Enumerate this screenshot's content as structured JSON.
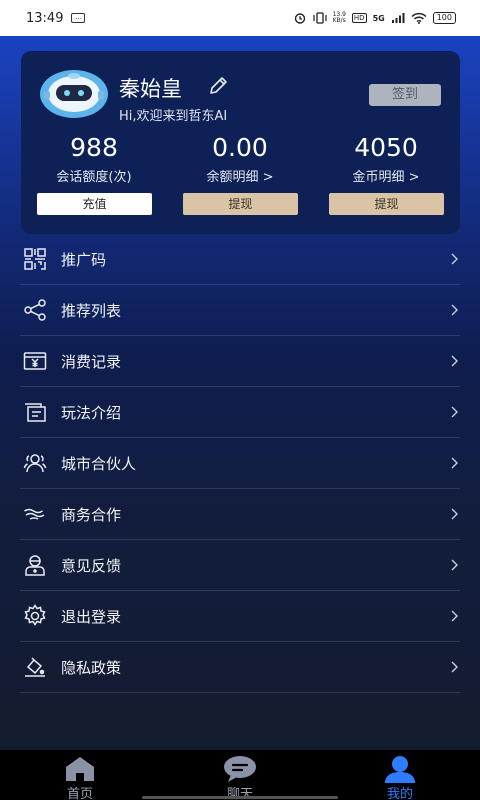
{
  "status": {
    "time": "13:49",
    "net_speed": "13.9\nKB/s",
    "hd": "HD",
    "signal": "5G",
    "battery": "100"
  },
  "profile": {
    "name": "秦始皇",
    "welcome": "Hi,欢迎来到哲东AI",
    "signin_label": "签到"
  },
  "stats": [
    {
      "value": "988",
      "label": "会话额度(次)",
      "action": "充值"
    },
    {
      "value": "0.00",
      "label": "余额明细 >",
      "action": "提现"
    },
    {
      "value": "4050",
      "label": "金币明细 >",
      "action": "提现"
    }
  ],
  "menu": [
    {
      "label": "推广码",
      "icon": "qr-code-icon"
    },
    {
      "label": "推荐列表",
      "icon": "share-icon"
    },
    {
      "label": "消费记录",
      "icon": "yen-ticket-icon"
    },
    {
      "label": "玩法介绍",
      "icon": "document-icon"
    },
    {
      "label": "城市合伙人",
      "icon": "partners-icon"
    },
    {
      "label": "商务合作",
      "icon": "handshake-icon"
    },
    {
      "label": "意见反馈",
      "icon": "feedback-icon"
    },
    {
      "label": "退出登录",
      "icon": "settings-gear-icon"
    },
    {
      "label": "隐私政策",
      "icon": "privacy-icon"
    }
  ],
  "tabs": [
    {
      "label": "首页",
      "icon": "home-icon",
      "active": false
    },
    {
      "label": "聊天",
      "icon": "chat-icon",
      "active": false
    },
    {
      "label": "我的",
      "icon": "user-icon",
      "active": true
    }
  ],
  "colors": {
    "accent": "#2f7dff",
    "card_bg": "#0e2157",
    "tan_button": "#d9c5a6",
    "signin_button": "#aeb4bf"
  }
}
